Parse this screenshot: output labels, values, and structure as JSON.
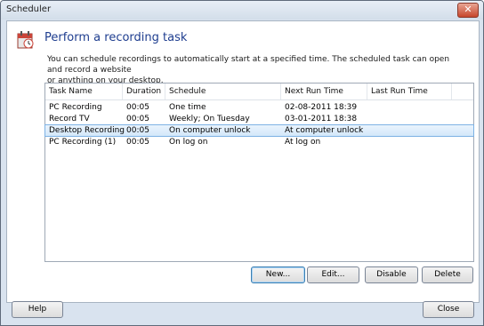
{
  "window": {
    "title": "Scheduler",
    "close_glyph": "✕"
  },
  "header": {
    "title": "Perform a recording task",
    "icon": "scheduler-icon",
    "description_line1": "You can schedule recordings to automatically start at a specified time.  The scheduled task can open and record a website",
    "description_line2": "or anything on your desktop."
  },
  "table": {
    "columns": [
      "Task Name",
      "Duration",
      "Schedule",
      "Next Run Time",
      "Last Run Time"
    ],
    "rows": [
      {
        "name": "PC Recording",
        "duration": "00:05",
        "schedule": "One time",
        "next_run": "02-08-2011 18:39",
        "last_run": ""
      },
      {
        "name": "Record TV",
        "duration": "00:05",
        "schedule": "Weekly; On Tuesday",
        "next_run": "03-01-2011 18:38",
        "last_run": ""
      },
      {
        "name": "Desktop Recording",
        "duration": "00:05",
        "schedule": "On computer unlock",
        "next_run": "At computer unlock",
        "last_run": ""
      },
      {
        "name": "PC Recording (1)",
        "duration": "00:05",
        "schedule": "On log on",
        "next_run": "At log on",
        "last_run": ""
      }
    ],
    "selected_index": 2
  },
  "buttons": {
    "new": "New...",
    "edit": "Edit...",
    "disable": "Disable",
    "delete": "Delete",
    "help": "Help",
    "close": "Close"
  }
}
